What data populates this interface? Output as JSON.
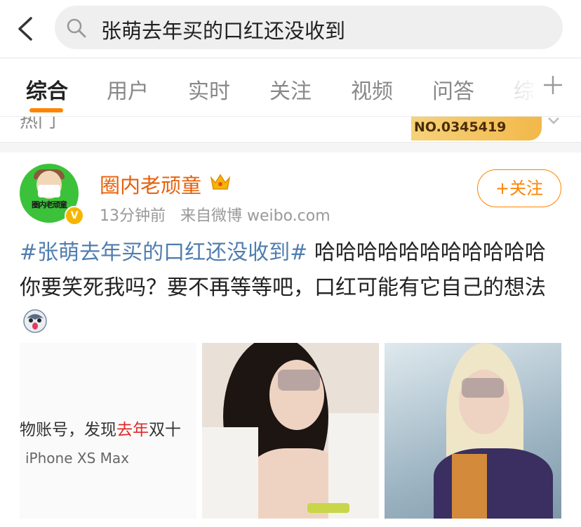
{
  "search": {
    "query": "张萌去年买的口红还没收到"
  },
  "tabs": [
    {
      "label": "综合"
    },
    {
      "label": "用户"
    },
    {
      "label": "实时"
    },
    {
      "label": "关注"
    },
    {
      "label": "视频"
    },
    {
      "label": "问答"
    },
    {
      "label": "综"
    }
  ],
  "hot_strip": {
    "partial_label": "热门",
    "banner_text": "NO.0345419"
  },
  "post": {
    "username": "圈内老顽童",
    "avatar_sign": "圈内老顽童",
    "time": "13分钟前",
    "source": "来自微博 weibo.com",
    "follow_label": "+关注",
    "topic": "#张萌去年买的口红还没收到#",
    "text": " 哈哈哈哈哈哈哈哈哈哈哈你要笑死我吗？要不再等等吧，口红可能有它自己的想法",
    "images": [
      {
        "line1_prefix": "物账号，发现",
        "line1_highlight": "去年",
        "line1_suffix": "双十",
        "line2": "iPhone XS Max"
      },
      {},
      {}
    ]
  },
  "colors": {
    "accent": "#ff8200",
    "username": "#e8600a",
    "topic": "#507daf",
    "vip": "#f7b500"
  }
}
